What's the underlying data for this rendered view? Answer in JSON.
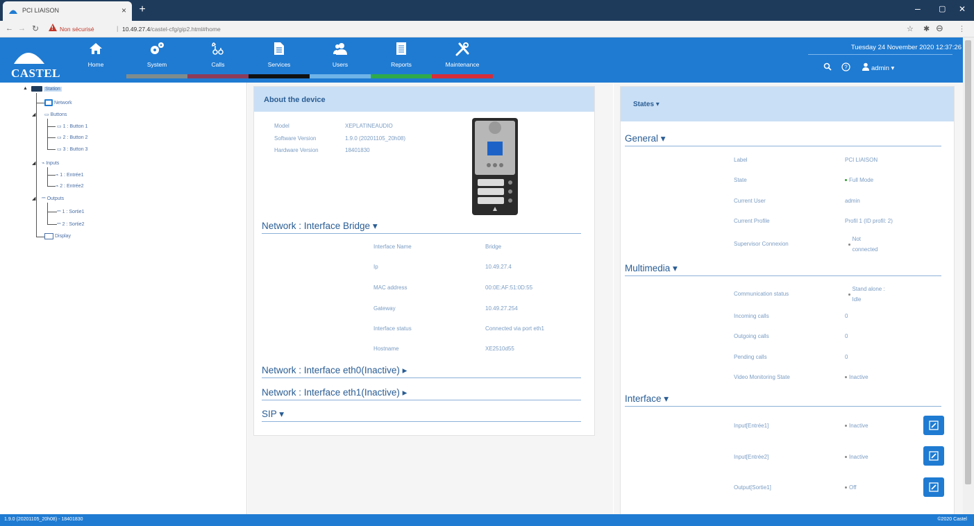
{
  "browser": {
    "tab_title": "PCI LIAISON",
    "tab_close": "×",
    "new_tab": "+",
    "win_min": "–",
    "win_max": "▢",
    "win_close": "✕",
    "insecure_label": "Non sécurisé",
    "url_host": "10.49.27.4",
    "url_path": "/castel-cfg/gip2.html#home"
  },
  "header": {
    "logo_text": "CASTEL",
    "menu": [
      {
        "label": "Home",
        "icon": "home-icon",
        "bar_color": ""
      },
      {
        "label": "System",
        "icon": "gears-icon",
        "bar_color": "#7f8c8d"
      },
      {
        "label": "Calls",
        "icon": "phone-icon",
        "bar_color": "#8e3b5a"
      },
      {
        "label": "Services",
        "icon": "document-icon",
        "bar_color": "#111111"
      },
      {
        "label": "Users",
        "icon": "users-icon",
        "bar_color": "#6fb4e8"
      },
      {
        "label": "Reports",
        "icon": "reports-icon",
        "bar_color": "#2eaa4a"
      },
      {
        "label": "Maintenance",
        "icon": "tools-icon",
        "bar_color": "#d62d3a"
      }
    ],
    "datetime": "Tuesday 24 November 2020 12:37:26",
    "user": "admin ▾"
  },
  "tree": {
    "root": "Station",
    "network": "Network",
    "buttons": "Buttons",
    "button_items": [
      "1 : Button 1",
      "2 : Button 2",
      "3 : Button 3"
    ],
    "inputs": "Inputs",
    "input_items": [
      "1 : Entrée1",
      "2 : Entrée2"
    ],
    "outputs": "Outputs",
    "output_items": [
      "1 : Sortie1",
      "2 : Sortie2"
    ],
    "display": "Display"
  },
  "about": {
    "title": "About the device",
    "model_label": "Model",
    "model_value": "XEPLATINEAUDIO",
    "sw_label": "Software Version",
    "sw_value": "1.9.0 (20201105_20h08)",
    "hw_label": "Hardware Version",
    "hw_value": "18401830"
  },
  "network": {
    "bridge_title": "Network : Interface Bridge ▾",
    "rows": [
      {
        "label": "Interface Name",
        "value": "Bridge"
      },
      {
        "label": "Ip",
        "value": "10.49.27.4"
      },
      {
        "label": "MAC address",
        "value": "00:0E:AF:51:0D:55"
      },
      {
        "label": "Gateway",
        "value": "10.49.27.254"
      },
      {
        "label": "Interface status",
        "value": "Connected via port eth1"
      },
      {
        "label": "Hostname",
        "value": "XE2510d55"
      }
    ],
    "eth0_title": "Network : Interface eth0(Inactive) ▸",
    "eth1_title": "Network : Interface eth1(Inactive) ▸",
    "sip_title": "SIP ▾"
  },
  "states": {
    "title": "States ▾",
    "general_title": "General ▾",
    "general": [
      {
        "label": "Label",
        "value": "PCI LIAISON"
      },
      {
        "label": "State",
        "value": "Full Mode"
      },
      {
        "label": "Current User",
        "value": "admin"
      },
      {
        "label": "Current Profile",
        "value": "Profil 1 (ID profil: 2)"
      },
      {
        "label": "Supervisor Connexion",
        "value": "Not connected"
      }
    ],
    "multimedia_title": "Multimedia ▾",
    "multimedia": [
      {
        "label": "Communication status",
        "value": "Stand alone : Idle"
      },
      {
        "label": "Incoming calls",
        "value": "0"
      },
      {
        "label": "Outgoing calls",
        "value": "0"
      },
      {
        "label": "Pending calls",
        "value": "0"
      },
      {
        "label": "Video Monitoring State",
        "value": "Inactive"
      }
    ],
    "interface_title": "Interface ▾",
    "interface": [
      {
        "label": "Input[Entrée1]",
        "value": "Inactive"
      },
      {
        "label": "Input[Entrée2]",
        "value": "Inactive"
      },
      {
        "label": "Output[Sortie1]",
        "value": "Off"
      }
    ]
  },
  "footer": {
    "left": "1.9.0 (20201105_20h08) - 18401830",
    "right": "©2020 Castel"
  },
  "colors": {
    "brand_blue": "#1f7bd2",
    "panel_header": "#c9dff5",
    "label_text": "#7a9cc3",
    "status_green": "#2ca02c"
  }
}
